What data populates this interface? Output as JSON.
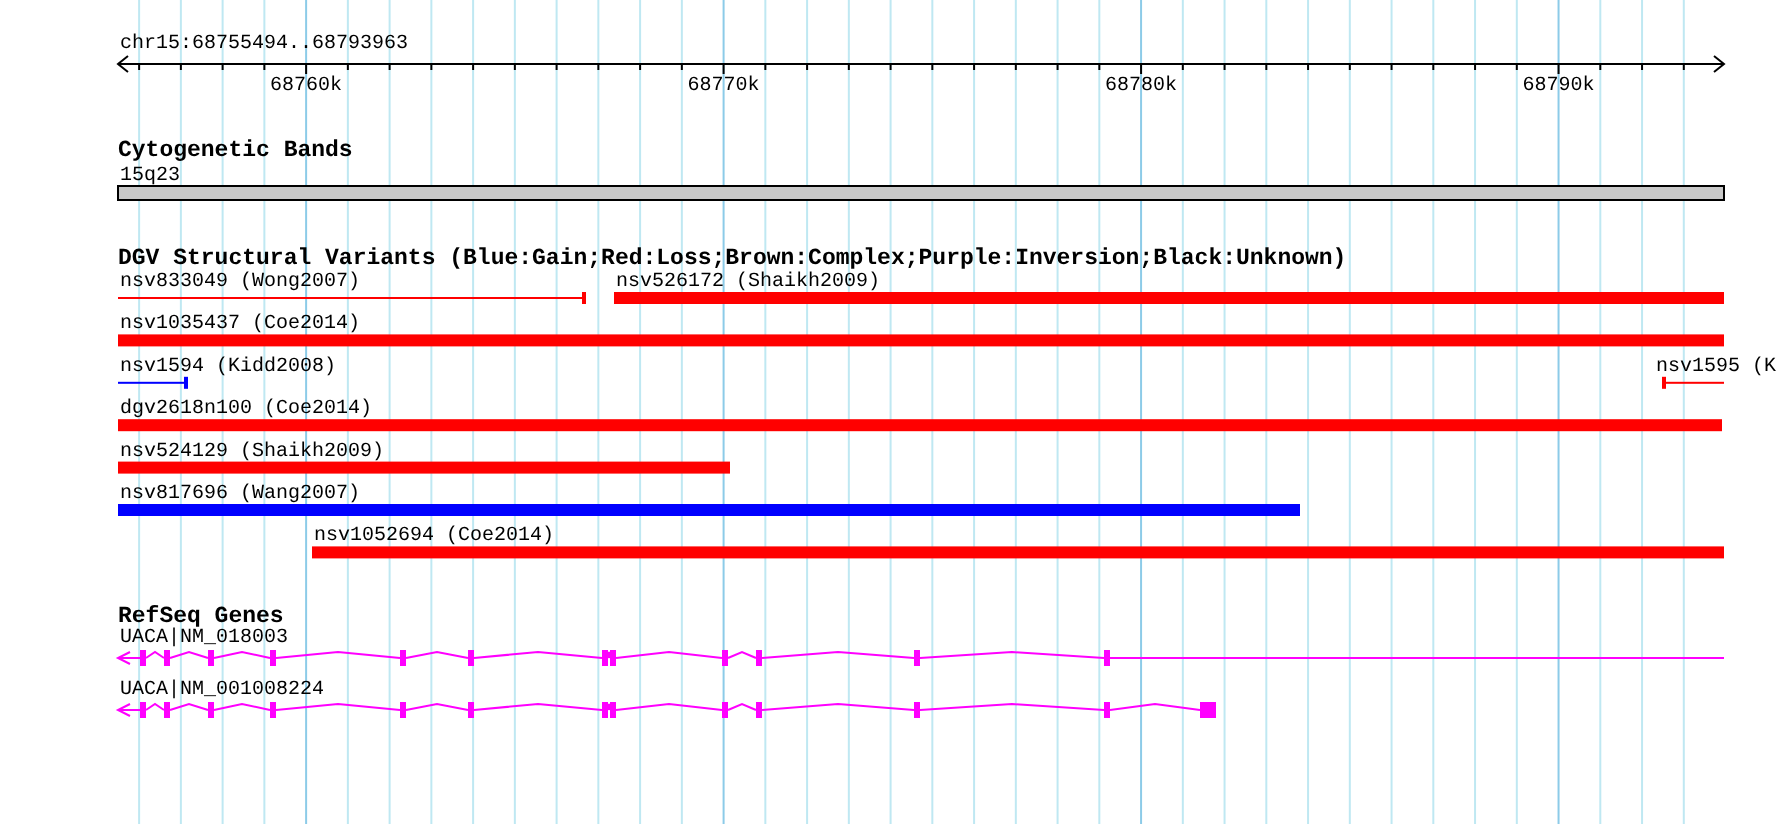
{
  "view": {
    "label": "chr15:68755494..68793963"
  },
  "ruler": {
    "ticks": [
      {
        "label": "68760k"
      },
      {
        "label": "68770k"
      },
      {
        "label": "68780k"
      },
      {
        "label": "68790k"
      }
    ]
  },
  "cytoband_track": {
    "title": "Cytogenetic Bands",
    "band": {
      "name": "15q23"
    }
  },
  "variant_track": {
    "title": "DGV Structural Variants (Blue:Gain;Red:Loss;Brown:Complex;Purple:Inversion;Black:Unknown)",
    "rows": [
      {
        "variants": [
          {
            "name": "nsv833049 (Wong2007)",
            "kind": "line",
            "color": "#ff0000"
          },
          {
            "name": "nsv526172 (Shaikh2009)",
            "kind": "bar",
            "color": "#ff0000"
          }
        ]
      },
      {
        "variants": [
          {
            "name": "nsv1035437 (Coe2014)",
            "kind": "bar",
            "color": "#ff0000"
          }
        ]
      },
      {
        "variants": [
          {
            "name": "nsv1594 (Kidd2008)",
            "kind": "line",
            "color": "#0000ff"
          },
          {
            "name": "nsv1595 (K",
            "kind": "line",
            "color": "#ff0000"
          }
        ]
      },
      {
        "variants": [
          {
            "name": "dgv2618n100 (Coe2014)",
            "kind": "bar",
            "color": "#ff0000"
          }
        ]
      },
      {
        "variants": [
          {
            "name": "nsv524129 (Shaikh2009)",
            "kind": "bar",
            "color": "#ff0000"
          }
        ]
      },
      {
        "variants": [
          {
            "name": "nsv817696 (Wang2007)",
            "kind": "bar",
            "color": "#0000ff"
          }
        ]
      },
      {
        "variants": [
          {
            "name": "nsv1052694 (Coe2014)",
            "kind": "bar",
            "color": "#ff0000"
          }
        ]
      }
    ]
  },
  "gene_track": {
    "title": "RefSeq Genes",
    "genes": [
      {
        "name": "UACA|NM_018003"
      },
      {
        "name": "UACA|NM_001008224"
      }
    ]
  }
}
